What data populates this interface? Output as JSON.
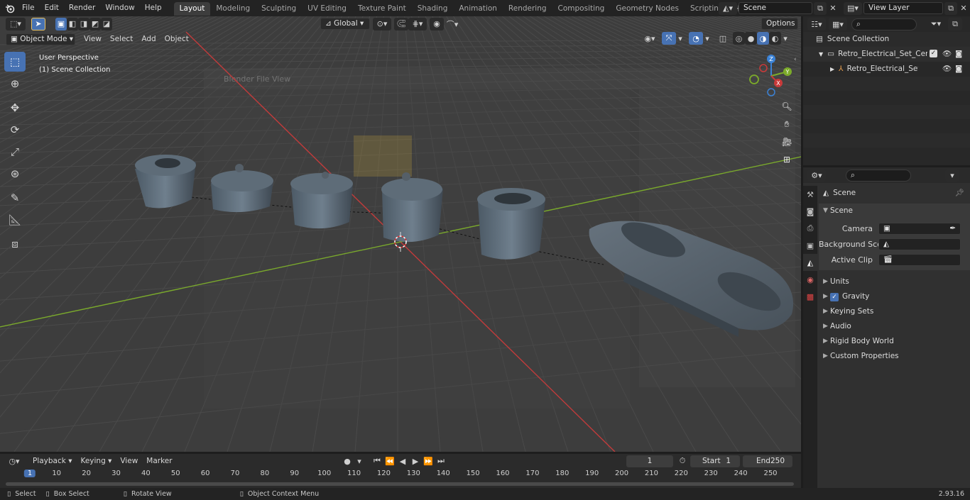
{
  "topbar": {
    "menus": [
      "File",
      "Edit",
      "Render",
      "Window",
      "Help"
    ],
    "workspaces": [
      "Layout",
      "Modeling",
      "Sculpting",
      "UV Editing",
      "Texture Paint",
      "Shading",
      "Animation",
      "Rendering",
      "Compositing",
      "Geometry Nodes",
      "Scripting"
    ],
    "active_workspace": "Layout",
    "scene_name": "Scene",
    "view_layer": "View Layer"
  },
  "viewport": {
    "mode": "Object Mode",
    "menus": [
      "View",
      "Select",
      "Add",
      "Object"
    ],
    "orientation": "Global",
    "options_label": "Options",
    "overlay_line1": "User Perspective",
    "overlay_line2": "(1) Scene Collection",
    "ghost_window_title": "Blender File View",
    "gizmo_axes": {
      "x": "X",
      "y": "Y",
      "z": "Z"
    }
  },
  "outliner": {
    "root": "Scene Collection",
    "items": [
      {
        "label": "Retro_Electrical_Set_Ceramic_"
      },
      {
        "label": "Retro_Electrical_Set_Cera"
      }
    ]
  },
  "properties": {
    "header": "Scene",
    "section": "Scene",
    "fields": {
      "camera_label": "Camera",
      "background_label": "Background Scene",
      "clip_label": "Active Clip"
    },
    "subpanels": [
      "Units",
      "Gravity",
      "Keying Sets",
      "Audio",
      "Rigid Body World",
      "Custom Properties"
    ],
    "gravity_checked": true
  },
  "timeline": {
    "menus": [
      "Playback",
      "Keying",
      "View",
      "Marker"
    ],
    "current_frame": "1",
    "start_label": "Start",
    "start_value": "1",
    "end_label": "End",
    "end_value": "250",
    "ticks": [
      "1",
      "10",
      "20",
      "30",
      "40",
      "50",
      "60",
      "70",
      "80",
      "90",
      "100",
      "110",
      "120",
      "130",
      "140",
      "150",
      "160",
      "170",
      "180",
      "190",
      "200",
      "210",
      "220",
      "230",
      "240",
      "250"
    ]
  },
  "statusbar": {
    "items": [
      "Select",
      "Box Select",
      "Rotate View",
      "Object Context Menu"
    ],
    "version": "2.93.16"
  },
  "colors": {
    "accent": "#4772b3",
    "x_axis": "#c83a3a",
    "y_axis": "#7cab2a",
    "z_axis": "#3b82d6"
  }
}
